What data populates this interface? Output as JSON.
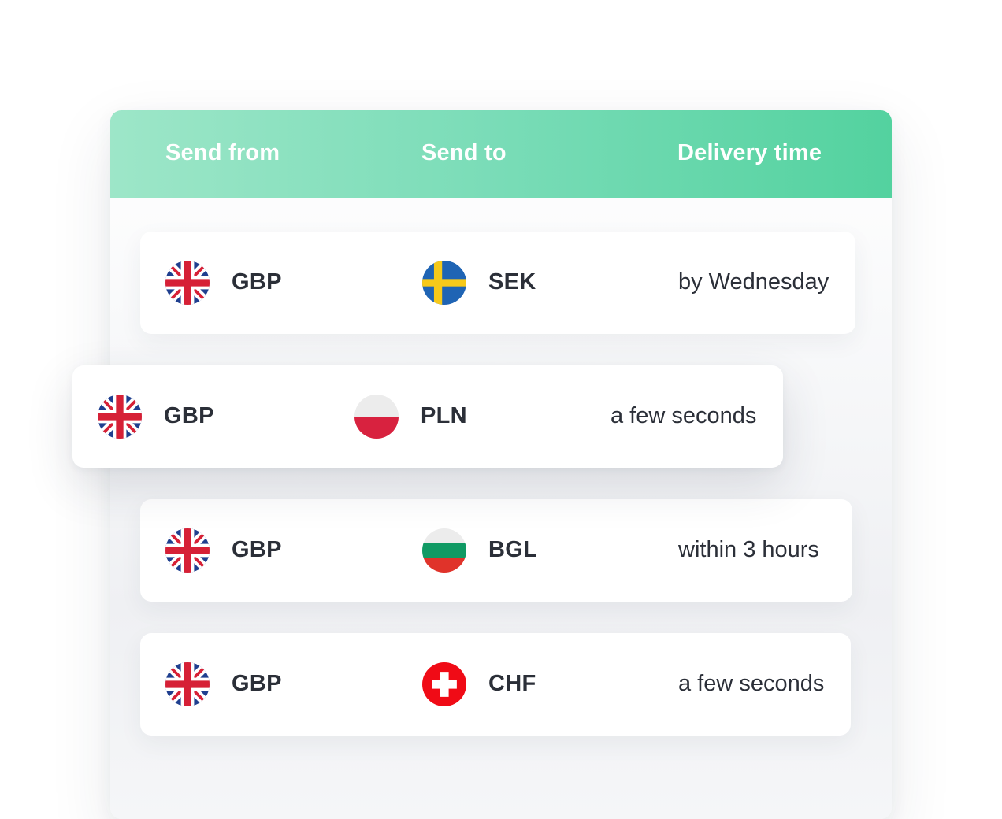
{
  "header": {
    "send_from": "Send from",
    "send_to": "Send to",
    "delivery_time": "Delivery time"
  },
  "rows": [
    {
      "from_code": "GBP",
      "from_flag": "uk-flag-icon",
      "to_code": "SEK",
      "to_flag": "sweden-flag-icon",
      "delivery": "by Wednesday"
    },
    {
      "from_code": "GBP",
      "from_flag": "uk-flag-icon",
      "to_code": "PLN",
      "to_flag": "poland-flag-icon",
      "delivery": "a few seconds"
    },
    {
      "from_code": "GBP",
      "from_flag": "uk-flag-icon",
      "to_code": "BGL",
      "to_flag": "bulgaria-flag-icon",
      "delivery": "within 3 hours"
    },
    {
      "from_code": "GBP",
      "from_flag": "uk-flag-icon",
      "to_code": "CHF",
      "to_flag": "switzerland-flag-icon",
      "delivery": "a few seconds"
    }
  ],
  "colors": {
    "header_gradient_start": "#9de6c8",
    "header_gradient_end": "#53d29f",
    "text": "#2b2f38"
  }
}
